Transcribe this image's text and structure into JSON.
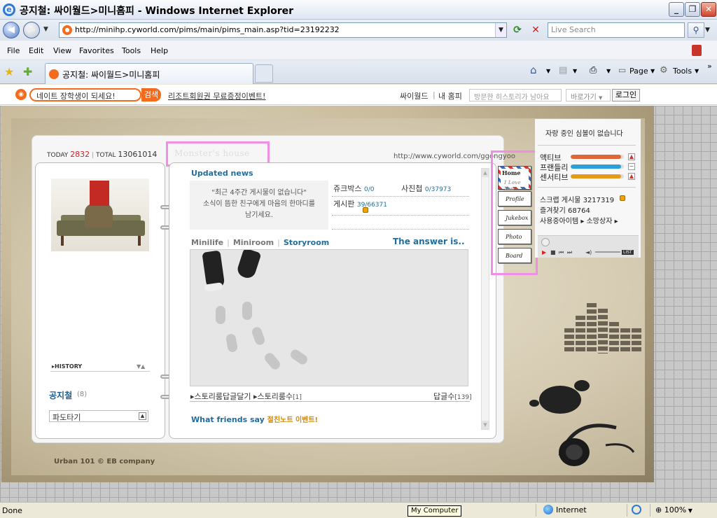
{
  "window": {
    "title": "공지철: 싸이월드>미니홈피 - Windows Internet Explorer",
    "min": "_",
    "max": "❐",
    "close": "✕"
  },
  "address": {
    "url": "http://minihp.cyworld.com/pims/main/pims_main.asp?tid=23192232",
    "search_placeholder": "Live Search"
  },
  "menu": [
    "File",
    "Edit",
    "View",
    "Favorites",
    "Tools",
    "Help"
  ],
  "tab": {
    "label": "공지철: 싸이월드>미니홈피"
  },
  "commands": {
    "page": "Page",
    "tools": "Tools"
  },
  "cybar": {
    "nate_input": "네이트 장학생이 되세요!",
    "nate_search": "검색",
    "promo": "리조트회원권 무료증정이벤트!",
    "cyworld": "싸이월드",
    "my_home": "내 홈피",
    "visit_placeholder": "방문한 히스토리가 남아요",
    "shortcut": "바로가기",
    "login": "로그인"
  },
  "home": {
    "today_label": "TODAY",
    "today": "2832",
    "total_label": "TOTAL",
    "total": "13061014",
    "title": "Monster's house",
    "url": "http://www.cyworld.com/ggongyoo",
    "history": "HISTORY",
    "owner": "공지철",
    "owner_count": "(8)",
    "wave": "파도타기",
    "brand": "Urban 101 © EB company"
  },
  "main": {
    "updated_news": "Updated news",
    "news_msg_1": "\"최근 4주간 게시물이 없습니다\"",
    "news_msg_2": "소식이 뜸한 친구에게 마음의 한마디를",
    "news_msg_3": "남기세요.",
    "jukebox_label": "쥬크박스",
    "jukebox_count": "0/0",
    "photo_label": "사진첩",
    "photo_count": "0/37973",
    "board_label": "게시판",
    "board_count": "39/66371",
    "tab_minilife": "Minilife",
    "tab_miniroom": "Miniroom",
    "tab_storyroom": "Storyroom",
    "answer": "The answer is..",
    "story_reply": "스토리룸답글달기",
    "story_count_label": "스토리룸수",
    "story_count": "[1]",
    "reply_count_label": "답글수",
    "reply_count": "[139]",
    "friends_say": "What friends say",
    "friends_event": "절친노트 이벤트!"
  },
  "side_menu": {
    "home": "Home",
    "home_sub": "I Love You",
    "profile": "Profile",
    "jukebox": "Jukebox",
    "photo": "Photo",
    "board": "Board"
  },
  "right": {
    "title": "자랑 중인 심볼이 없습니다",
    "active": "액티브",
    "friendly": "프랜들리",
    "sensitive": "센서티브",
    "active_level": 0.95,
    "friendly_level": 0.95,
    "sensitive_level": 0.95,
    "scrap_label": "스크랩 게시물",
    "scrap_count": "3217319",
    "favorites_label": "즐겨찾기",
    "favorites_count": "68764",
    "items_label": "사용중아이템",
    "storeroom": "소망상자",
    "list": "LIST"
  },
  "status": {
    "done": "Done",
    "tooltip": "My Computer",
    "zone": "Internet",
    "zoom": "100%"
  },
  "colors": {
    "active": "#e0663a",
    "friendly": "#2aa0d6",
    "sensitive": "#e59a1a",
    "accent": "#1f6e9e",
    "highlight": "#f08ee6"
  }
}
